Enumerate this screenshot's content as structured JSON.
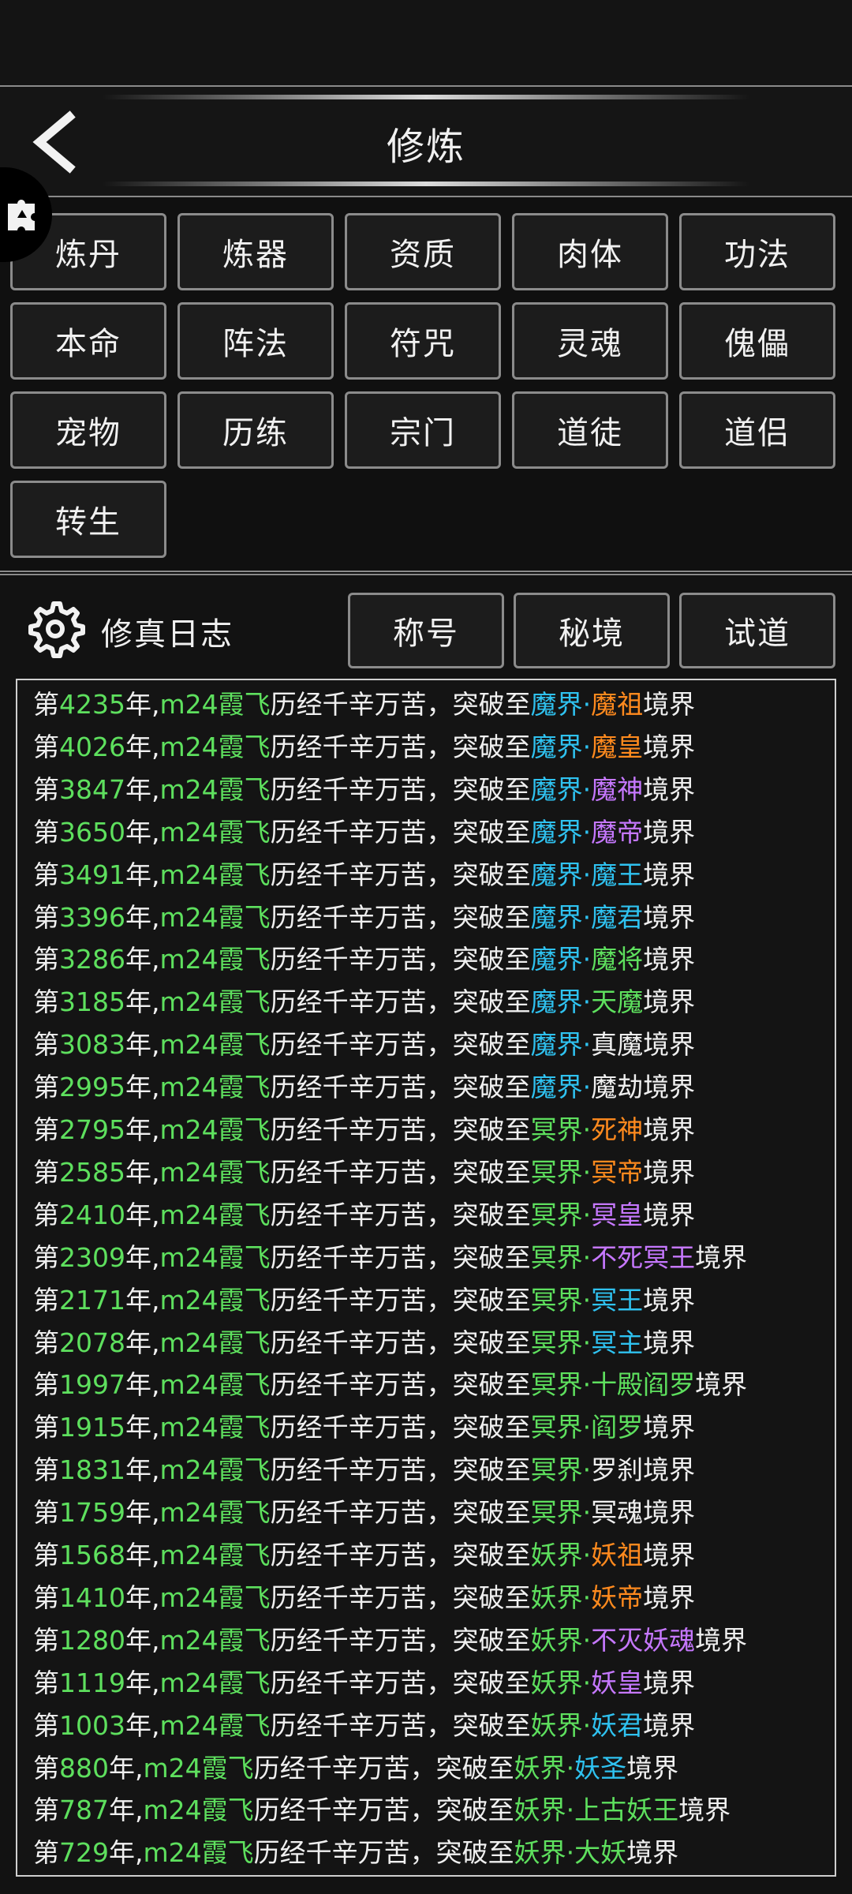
{
  "header": {
    "title": "修炼"
  },
  "grid": [
    [
      "炼丹",
      "炼器",
      "资质",
      "肉体",
      "功法"
    ],
    [
      "本命",
      "阵法",
      "符咒",
      "灵魂",
      "傀儡"
    ],
    [
      "宠物",
      "历练",
      "宗门",
      "道徒",
      "道侣"
    ],
    [
      "转生"
    ]
  ],
  "diary": {
    "title": "修真日志",
    "tabs": [
      "称号",
      "秘境",
      "试道"
    ]
  },
  "log_template": {
    "prefix": "第",
    "year_suffix": "年,",
    "player": "m24霞飞",
    "middle": "历经千辛万苦，突破至",
    "dot": "·",
    "suffix": "境界"
  },
  "colors": {
    "green": "#5ee05e",
    "blue": "#2fc2f0",
    "orange": "#ff8a1e",
    "purple": "#c678ff",
    "white": "#f0f0f0"
  },
  "logs": [
    {
      "year": "4235",
      "realm": "魔界",
      "realm_color": "blue",
      "stage": "魔祖",
      "stage_color": "orange"
    },
    {
      "year": "4026",
      "realm": "魔界",
      "realm_color": "blue",
      "stage": "魔皇",
      "stage_color": "orange"
    },
    {
      "year": "3847",
      "realm": "魔界",
      "realm_color": "blue",
      "stage": "魔神",
      "stage_color": "purple"
    },
    {
      "year": "3650",
      "realm": "魔界",
      "realm_color": "blue",
      "stage": "魔帝",
      "stage_color": "purple"
    },
    {
      "year": "3491",
      "realm": "魔界",
      "realm_color": "blue",
      "stage": "魔王",
      "stage_color": "blue"
    },
    {
      "year": "3396",
      "realm": "魔界",
      "realm_color": "blue",
      "stage": "魔君",
      "stage_color": "blue"
    },
    {
      "year": "3286",
      "realm": "魔界",
      "realm_color": "blue",
      "stage": "魔将",
      "stage_color": "green"
    },
    {
      "year": "3185",
      "realm": "魔界",
      "realm_color": "blue",
      "stage": "天魔",
      "stage_color": "green"
    },
    {
      "year": "3083",
      "realm": "魔界",
      "realm_color": "blue",
      "stage": "真魔",
      "stage_color": "white"
    },
    {
      "year": "2995",
      "realm": "魔界",
      "realm_color": "blue",
      "stage": "魔劫",
      "stage_color": "white"
    },
    {
      "year": "2795",
      "realm": "冥界",
      "realm_color": "green",
      "stage": "死神",
      "stage_color": "orange"
    },
    {
      "year": "2585",
      "realm": "冥界",
      "realm_color": "green",
      "stage": "冥帝",
      "stage_color": "orange"
    },
    {
      "year": "2410",
      "realm": "冥界",
      "realm_color": "green",
      "stage": "冥皇",
      "stage_color": "purple"
    },
    {
      "year": "2309",
      "realm": "冥界",
      "realm_color": "green",
      "stage": "不死冥王",
      "stage_color": "purple"
    },
    {
      "year": "2171",
      "realm": "冥界",
      "realm_color": "green",
      "stage": "冥王",
      "stage_color": "blue"
    },
    {
      "year": "2078",
      "realm": "冥界",
      "realm_color": "green",
      "stage": "冥主",
      "stage_color": "blue"
    },
    {
      "year": "1997",
      "realm": "冥界",
      "realm_color": "green",
      "stage": "十殿阎罗",
      "stage_color": "green"
    },
    {
      "year": "1915",
      "realm": "冥界",
      "realm_color": "green",
      "stage": "阎罗",
      "stage_color": "green"
    },
    {
      "year": "1831",
      "realm": "冥界",
      "realm_color": "green",
      "stage": "罗刹",
      "stage_color": "white"
    },
    {
      "year": "1759",
      "realm": "冥界",
      "realm_color": "green",
      "stage": "冥魂",
      "stage_color": "white"
    },
    {
      "year": "1568",
      "realm": "妖界",
      "realm_color": "green",
      "stage": "妖祖",
      "stage_color": "orange"
    },
    {
      "year": "1410",
      "realm": "妖界",
      "realm_color": "green",
      "stage": "妖帝",
      "stage_color": "orange"
    },
    {
      "year": "1280",
      "realm": "妖界",
      "realm_color": "green",
      "stage": "不灭妖魂",
      "stage_color": "purple"
    },
    {
      "year": "1119",
      "realm": "妖界",
      "realm_color": "green",
      "stage": "妖皇",
      "stage_color": "purple"
    },
    {
      "year": "1003",
      "realm": "妖界",
      "realm_color": "green",
      "stage": "妖君",
      "stage_color": "blue"
    },
    {
      "year": "880",
      "realm": "妖界",
      "realm_color": "green",
      "stage": "妖圣",
      "stage_color": "blue"
    },
    {
      "year": "787",
      "realm": "妖界",
      "realm_color": "green",
      "stage": "上古妖王",
      "stage_color": "green"
    },
    {
      "year": "729",
      "realm": "妖界",
      "realm_color": "green",
      "stage": "大妖",
      "stage_color": "green"
    }
  ]
}
